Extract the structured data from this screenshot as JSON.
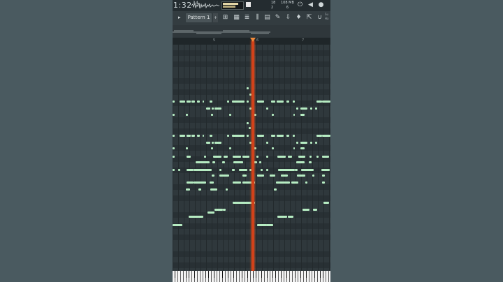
{
  "status_bar": {
    "time": "1:32",
    "time_superscript": "34",
    "cpu_top": "18",
    "cpu_bottom": "2",
    "memory_top": "108 MB",
    "memory_bottom": "6"
  },
  "toolbar": {
    "pattern_label": "Pattern 1",
    "pattern_add": "+",
    "right_text_top": "Su",
    "right_text_bottom": "Ha"
  },
  "ruler": {
    "markers": [
      "5",
      "6",
      "7"
    ]
  },
  "icons": [
    "waveform-icon",
    "power-icon",
    "speaker-icon",
    "microphone-icon",
    "pencil-icon",
    "trash-icon",
    "select-icon",
    "slice-icon",
    "magnet-icon",
    "piano-icon",
    "mixer-icon",
    "playlist-icon"
  ],
  "colors": {
    "background": "#4a5a60",
    "note": "#b6ecc2",
    "playhead": "#d2421a",
    "playhead_marker": "#f28a3b"
  }
}
